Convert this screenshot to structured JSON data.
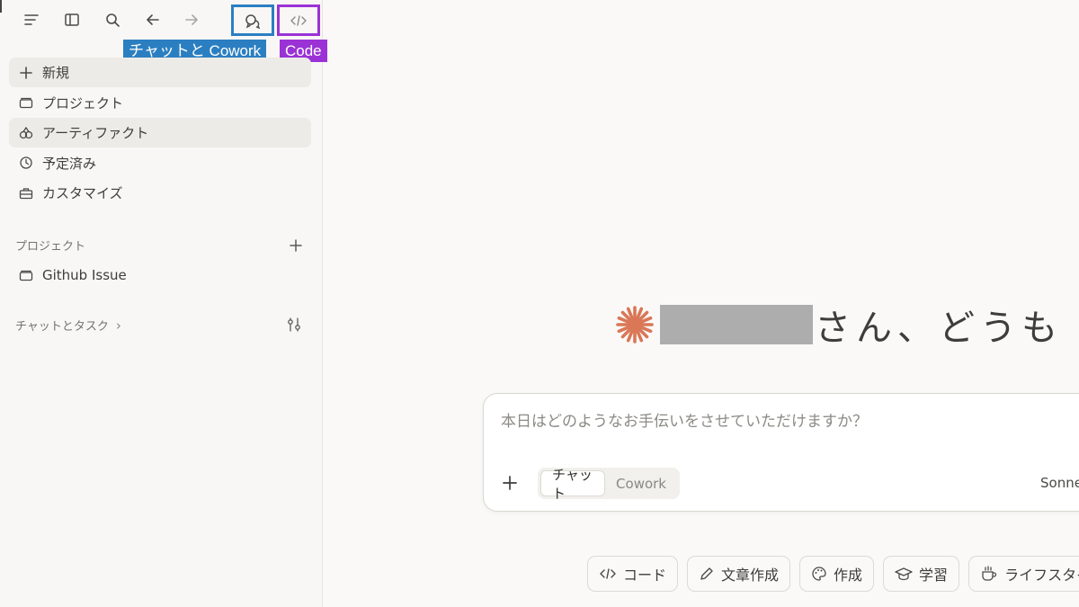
{
  "annotations": {
    "chat_cowork_tag": "チャットと Cowork",
    "code_tag": "Code"
  },
  "sidebar": {
    "nav": [
      {
        "label": "新規",
        "icon": "plus-icon"
      },
      {
        "label": "プロジェクト",
        "icon": "folder-icon"
      },
      {
        "label": "アーティファクト",
        "icon": "shapes-icon"
      },
      {
        "label": "予定済み",
        "icon": "clock-icon"
      },
      {
        "label": "カスタマイズ",
        "icon": "briefcase-icon"
      }
    ],
    "projects_heading": "プロジェクト",
    "projects": [
      {
        "label": "Github Issue",
        "icon": "folder-icon"
      }
    ],
    "chats_heading": "チャットとタスク",
    "chats_chevron": "›"
  },
  "main": {
    "greeting_suffix": "さん、どうも",
    "composer": {
      "placeholder": "本日はどのようなお手伝いをさせていただけますか？",
      "modes": [
        "チャット",
        "Cowork"
      ],
      "active_mode": "チャット",
      "model": "Sonnet"
    },
    "chips": [
      {
        "label": "コード",
        "icon": "code-icon"
      },
      {
        "label": "文章作成",
        "icon": "pen-icon"
      },
      {
        "label": "作成",
        "icon": "palette-icon"
      },
      {
        "label": "学習",
        "icon": "graduation-cap-icon"
      },
      {
        "label": "ライフスタイル",
        "icon": "coffee-icon"
      }
    ]
  },
  "colors": {
    "accent_spark": "#d97757",
    "annotation_blue": "#2b7fc1",
    "annotation_purple": "#9a32d6"
  }
}
